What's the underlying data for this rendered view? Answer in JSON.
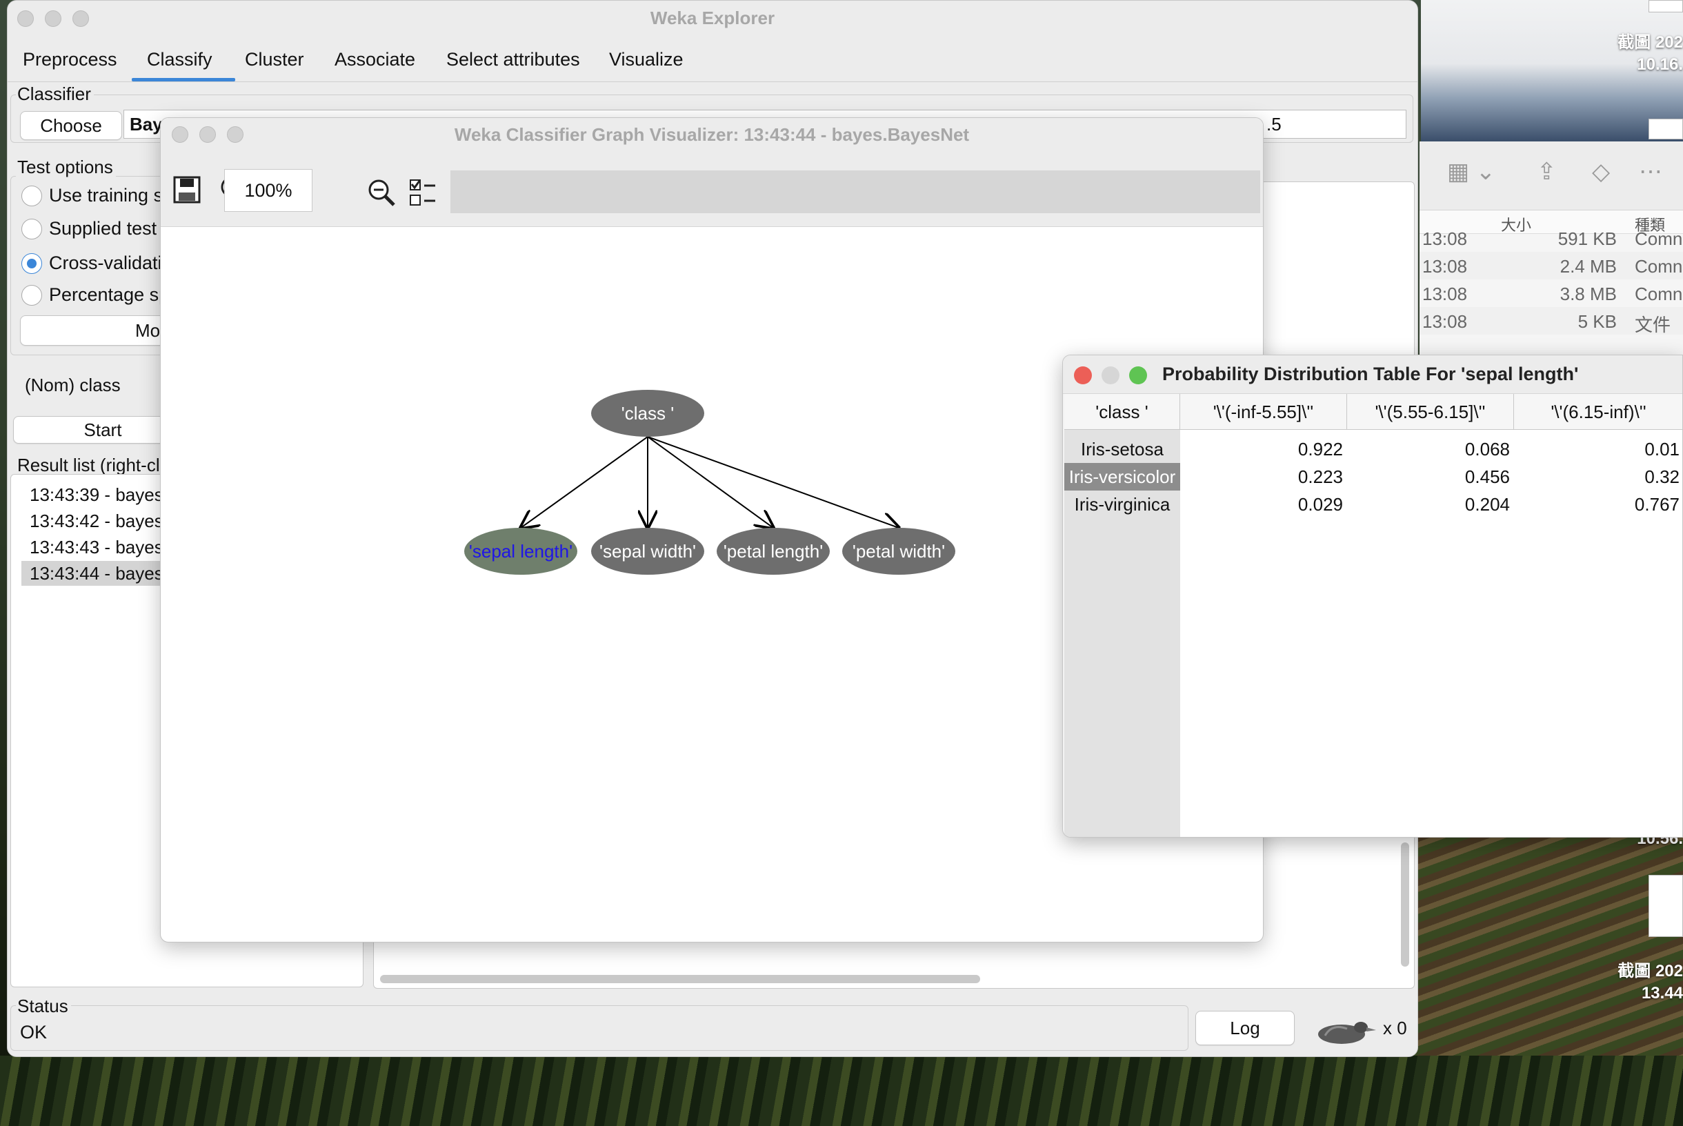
{
  "desktop": {
    "labels": [
      {
        "text": "截圖 202",
        "sub": "10.16."
      },
      {
        "text": "截圖 202",
        "sub": "13.44"
      }
    ],
    "partial_label": "10.56."
  },
  "finder": {
    "headers": {
      "size": "大小",
      "kind": "種類"
    },
    "rows": [
      {
        "time": "13:08",
        "size": "591 KB",
        "kind": "Comn"
      },
      {
        "time": "13:08",
        "size": "2.4 MB",
        "kind": "Comn"
      },
      {
        "time": "13:08",
        "size": "3.8 MB",
        "kind": "Comn"
      },
      {
        "time": "13:08",
        "size": "5 KB",
        "kind": "文件"
      }
    ]
  },
  "explorer": {
    "title": "Weka Explorer",
    "tabs": [
      "Preprocess",
      "Classify",
      "Cluster",
      "Associate",
      "Select attributes",
      "Visualize"
    ],
    "active_tab": "Classify",
    "classifier": {
      "group_label": "Classifier",
      "choose_label": "Choose",
      "value_visible": "Baye",
      "value_tail": ".5"
    },
    "test_options": {
      "group_label": "Test options",
      "options": [
        {
          "label": "Use training s",
          "checked": false
        },
        {
          "label": "Supplied test",
          "checked": false
        },
        {
          "label": "Cross-validati",
          "checked": true
        },
        {
          "label": "Percentage sp",
          "checked": false
        }
      ],
      "more_label": "More"
    },
    "class_select": "(Nom) class",
    "start_label": "Start",
    "result_list": {
      "label": "Result list (right-cl",
      "items": [
        "13:43:39 - bayes",
        "13:43:42 - bayes",
        "13:43:43 - bayes",
        "13:43:44 - bayes"
      ],
      "selected_index": 3
    },
    "status": {
      "group_label": "Status",
      "text": "OK",
      "log_label": "Log",
      "count": "x 0"
    }
  },
  "visualizer": {
    "title": "Weka Classifier Graph Visualizer: 13:43:44 - bayes.BayesNet",
    "zoom": "100%",
    "toolbar_icons": [
      "save-icon",
      "zoom-in-icon",
      "zoom-out-icon",
      "layout-options-icon"
    ],
    "graph": {
      "root": "'class '",
      "children": [
        "'sepal length'",
        "'sepal width'",
        "'petal length'",
        "'petal width'"
      ],
      "highlighted": "'sepal length'",
      "colors": {
        "node": "#6e6e6e",
        "highlight_node": "#6f7f6c",
        "highlight_text": "#1f16e6",
        "node_text": "#ffffff"
      }
    }
  },
  "probability_table": {
    "title": "Probability Distribution Table For 'sepal length'",
    "columns": [
      "'class '",
      "'\\'(-inf-5.55]\\''",
      "'\\'(5.55-6.15]\\''",
      "'\\'(6.15-inf)\\''"
    ],
    "rows": [
      {
        "label": "Iris-setosa",
        "values": [
          "0.922",
          "0.068",
          "0.01"
        ]
      },
      {
        "label": "Iris-versicolor",
        "values": [
          "0.223",
          "0.456",
          "0.32"
        ]
      },
      {
        "label": "Iris-virginica",
        "values": [
          "0.029",
          "0.204",
          "0.767"
        ]
      }
    ],
    "selected_row": 1,
    "window_buttons": {
      "close": "#ec5f57",
      "minimize": "#d6d6d6",
      "zoom": "#5fc453"
    }
  }
}
